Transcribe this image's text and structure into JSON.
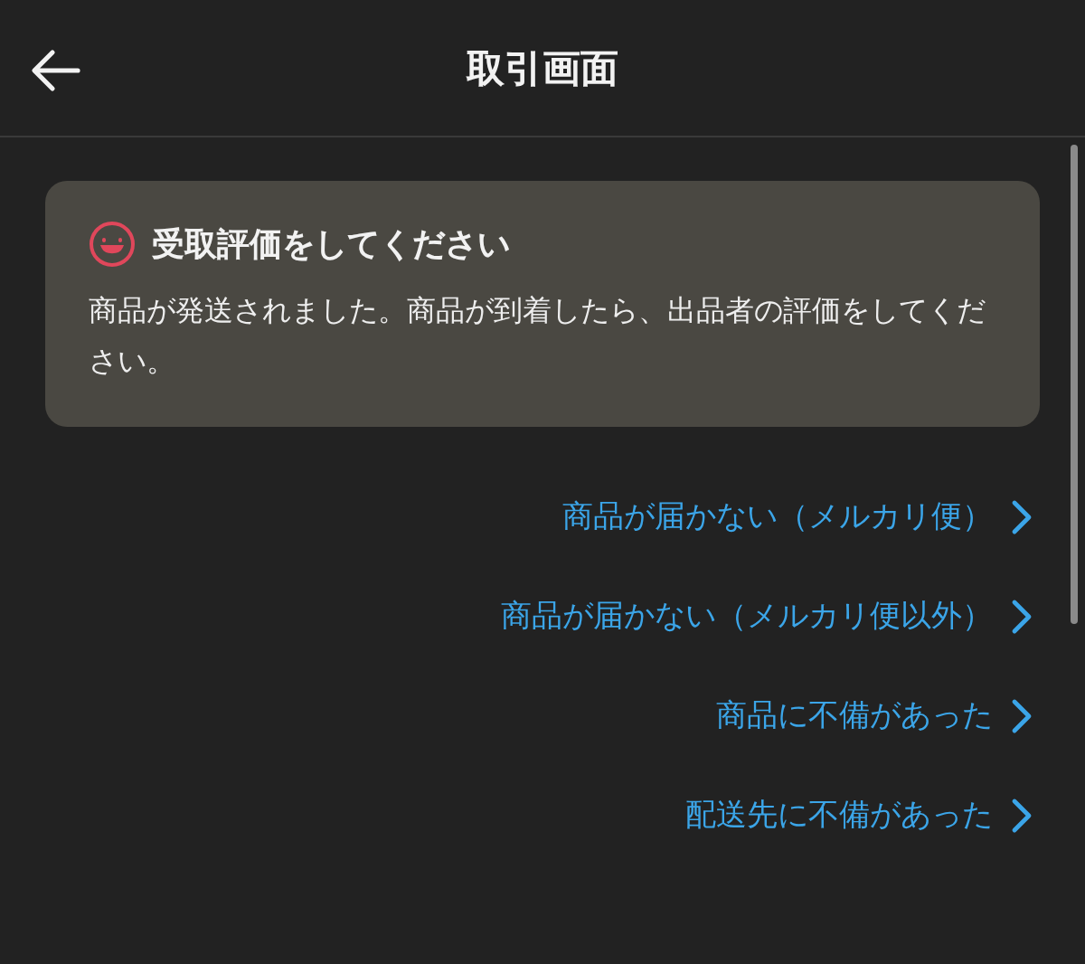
{
  "header": {
    "title": "取引画面"
  },
  "notice": {
    "title": "受取評価をしてください",
    "body": "商品が発送されました。商品が到着したら、出品者の評価をしてください。"
  },
  "links": [
    {
      "label": "商品が届かない（メルカリ便）"
    },
    {
      "label": "商品が届かない（メルカリ便以外）"
    },
    {
      "label": "商品に不備があった"
    },
    {
      "label": "配送先に不備があった"
    }
  ]
}
